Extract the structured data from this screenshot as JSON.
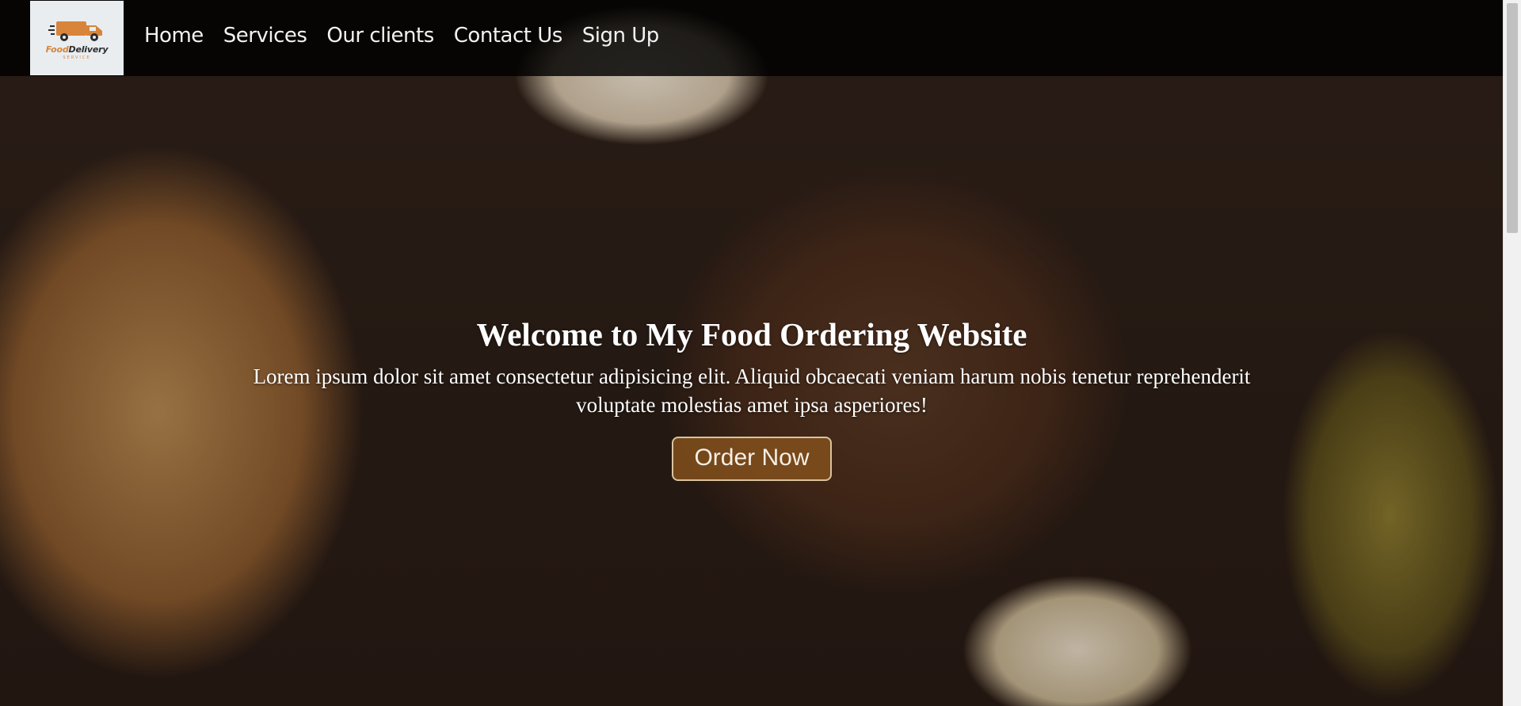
{
  "logo": {
    "icon": "delivery-truck-icon",
    "name_prefix": "Food",
    "name_suffix": "Delivery",
    "tagline": "SERVICE"
  },
  "nav": {
    "items": [
      {
        "label": "Home"
      },
      {
        "label": "Services"
      },
      {
        "label": "Our clients"
      },
      {
        "label": "Contact Us"
      },
      {
        "label": "Sign Up"
      }
    ]
  },
  "hero": {
    "title": "Welcome to My Food Ordering Website",
    "description": "Lorem ipsum dolor sit amet consectetur adipisicing elit. Aliquid obcaecati veniam harum nobis tenetur reprehenderit voluptate molestias amet ipsa asperiores!",
    "cta_label": "Order Now",
    "background": "food-table-photo"
  },
  "colors": {
    "navbar": "#000000",
    "accent": "#d8843b",
    "button": "#82501c"
  }
}
